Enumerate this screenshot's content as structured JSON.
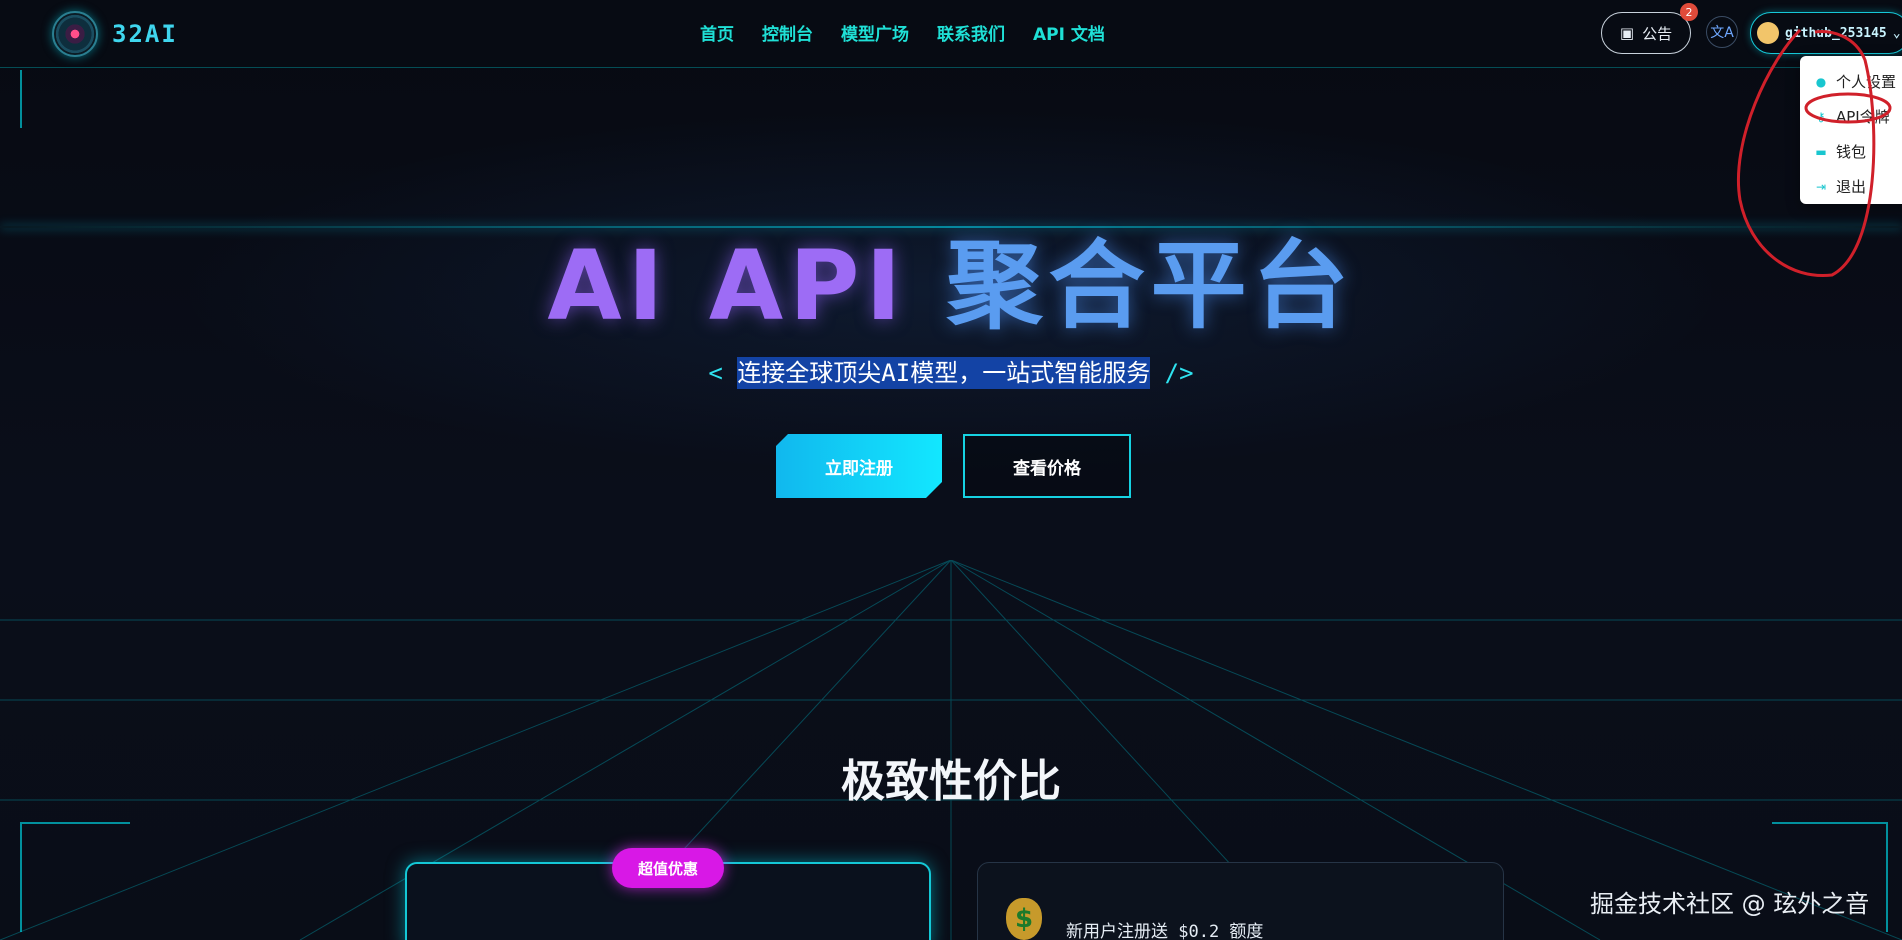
{
  "header": {
    "logo_text": "32AI",
    "nav": [
      "首页",
      "控制台",
      "模型广场",
      "联系我们",
      "API 文档"
    ],
    "notice_label": "公告",
    "notice_count": "2",
    "lang_icon": "文A",
    "username": "github_253145"
  },
  "dropdown": {
    "items": [
      {
        "label": "个人设置",
        "icon": "user-icon"
      },
      {
        "label": "API令牌",
        "icon": "key-icon"
      },
      {
        "label": "钱包",
        "icon": "wallet-icon"
      },
      {
        "label": "退出",
        "icon": "logout-icon"
      }
    ]
  },
  "hero": {
    "title_en": "AI API",
    "title_cn": "聚合平台",
    "subtitle_prefix": "< ",
    "subtitle_highlight": "连接全球顶尖AI模型，一站式智能服务",
    "subtitle_suffix": " />",
    "register_label": "立即注册",
    "price_label": "查看价格"
  },
  "section": {
    "title": "极致性价比",
    "badge": "超值优惠",
    "bonus_text": "新用户注册送 $0.2 额度"
  },
  "watermark": "掘金技术社区 @ 玹外之音",
  "colors": {
    "accent": "#16d2e2",
    "purple": "#9d6cf5",
    "blue": "#5a9cf0",
    "magenta": "#d818e6",
    "highlight": "#1343a5",
    "annotation": "#d0202a"
  }
}
